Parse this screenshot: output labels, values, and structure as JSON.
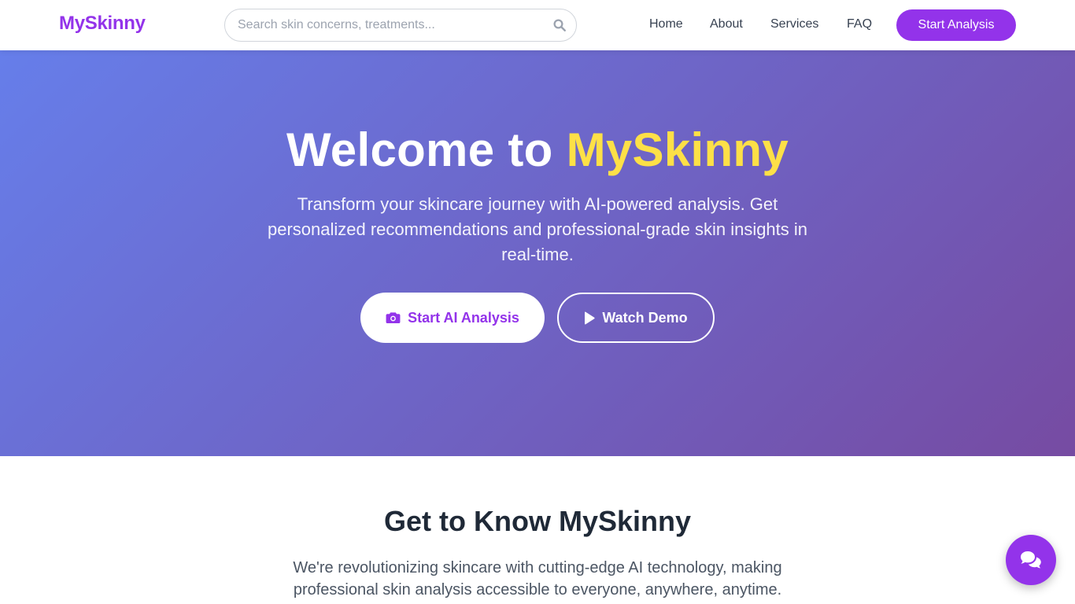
{
  "brand": {
    "name": "MySkinny",
    "color": "#9333ea"
  },
  "search": {
    "placeholder": "Search skin concerns, treatments...",
    "value": "",
    "icon": "search-icon"
  },
  "nav": {
    "items": [
      {
        "label": "Home"
      },
      {
        "label": "About"
      },
      {
        "label": "Services"
      },
      {
        "label": "FAQ"
      }
    ],
    "cta_label": "Start Analysis"
  },
  "hero": {
    "title_prefix": "Welcome to ",
    "title_accent": "MySkinny",
    "accent_color": "#fde047",
    "subtitle": "Transform your skincare journey with AI-powered analysis. Get personalized recommendations and professional-grade skin insights in real-time.",
    "primary_button": {
      "label": "Start AI Analysis",
      "icon": "camera-icon"
    },
    "secondary_button": {
      "label": "Watch Demo",
      "icon": "play-icon"
    },
    "gradient": [
      "#667eea",
      "#764ba2"
    ]
  },
  "about": {
    "title": "Get to Know MySkinny",
    "text": "We're revolutionizing skincare with cutting-edge AI technology, making professional skin analysis accessible to everyone, anywhere, anytime."
  },
  "chat": {
    "icon": "chat-bubbles-icon"
  }
}
